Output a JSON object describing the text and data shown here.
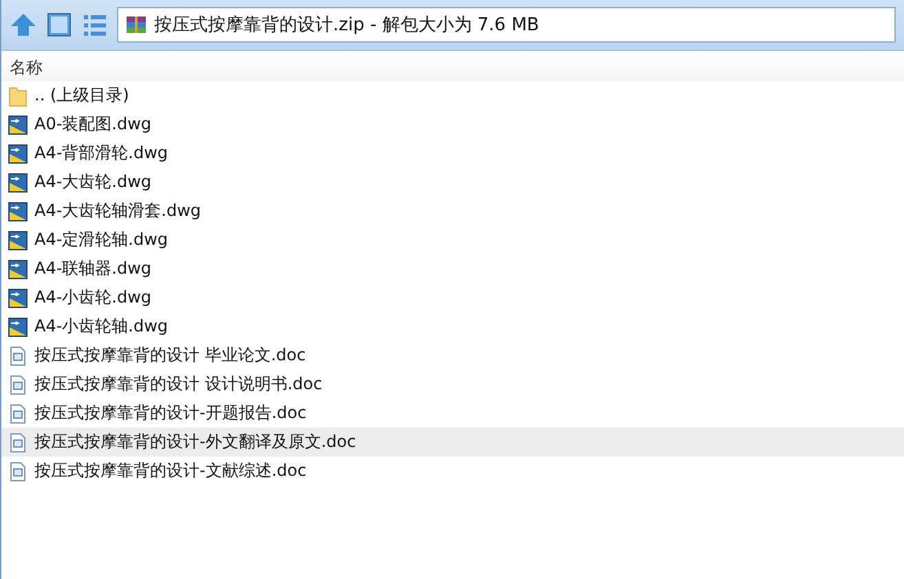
{
  "address_bar": {
    "text": "按压式按摩靠背的设计.zip - 解包大小为 7.6 MB"
  },
  "file_list": {
    "column_header": "名称",
    "items": [
      {
        "kind": "folder",
        "name": ".. (上级目录)",
        "selected": false
      },
      {
        "kind": "dwg",
        "name": "A0-装配图.dwg",
        "selected": false
      },
      {
        "kind": "dwg",
        "name": "A4-背部滑轮.dwg",
        "selected": false
      },
      {
        "kind": "dwg",
        "name": "A4-大齿轮.dwg",
        "selected": false
      },
      {
        "kind": "dwg",
        "name": "A4-大齿轮轴滑套.dwg",
        "selected": false
      },
      {
        "kind": "dwg",
        "name": "A4-定滑轮轴.dwg",
        "selected": false
      },
      {
        "kind": "dwg",
        "name": "A4-联轴器.dwg",
        "selected": false
      },
      {
        "kind": "dwg",
        "name": "A4-小齿轮.dwg",
        "selected": false
      },
      {
        "kind": "dwg",
        "name": "A4-小齿轮轴.dwg",
        "selected": false
      },
      {
        "kind": "doc",
        "name": "按压式按摩靠背的设计 毕业论文.doc",
        "selected": false
      },
      {
        "kind": "doc",
        "name": "按压式按摩靠背的设计 设计说明书.doc",
        "selected": false
      },
      {
        "kind": "doc",
        "name": "按压式按摩靠背的设计-开题报告.doc",
        "selected": false
      },
      {
        "kind": "doc",
        "name": "按压式按摩靠背的设计-外文翻译及原文.doc",
        "selected": true
      },
      {
        "kind": "doc",
        "name": "按压式按摩靠背的设计-文献综述.doc",
        "selected": false
      }
    ]
  }
}
